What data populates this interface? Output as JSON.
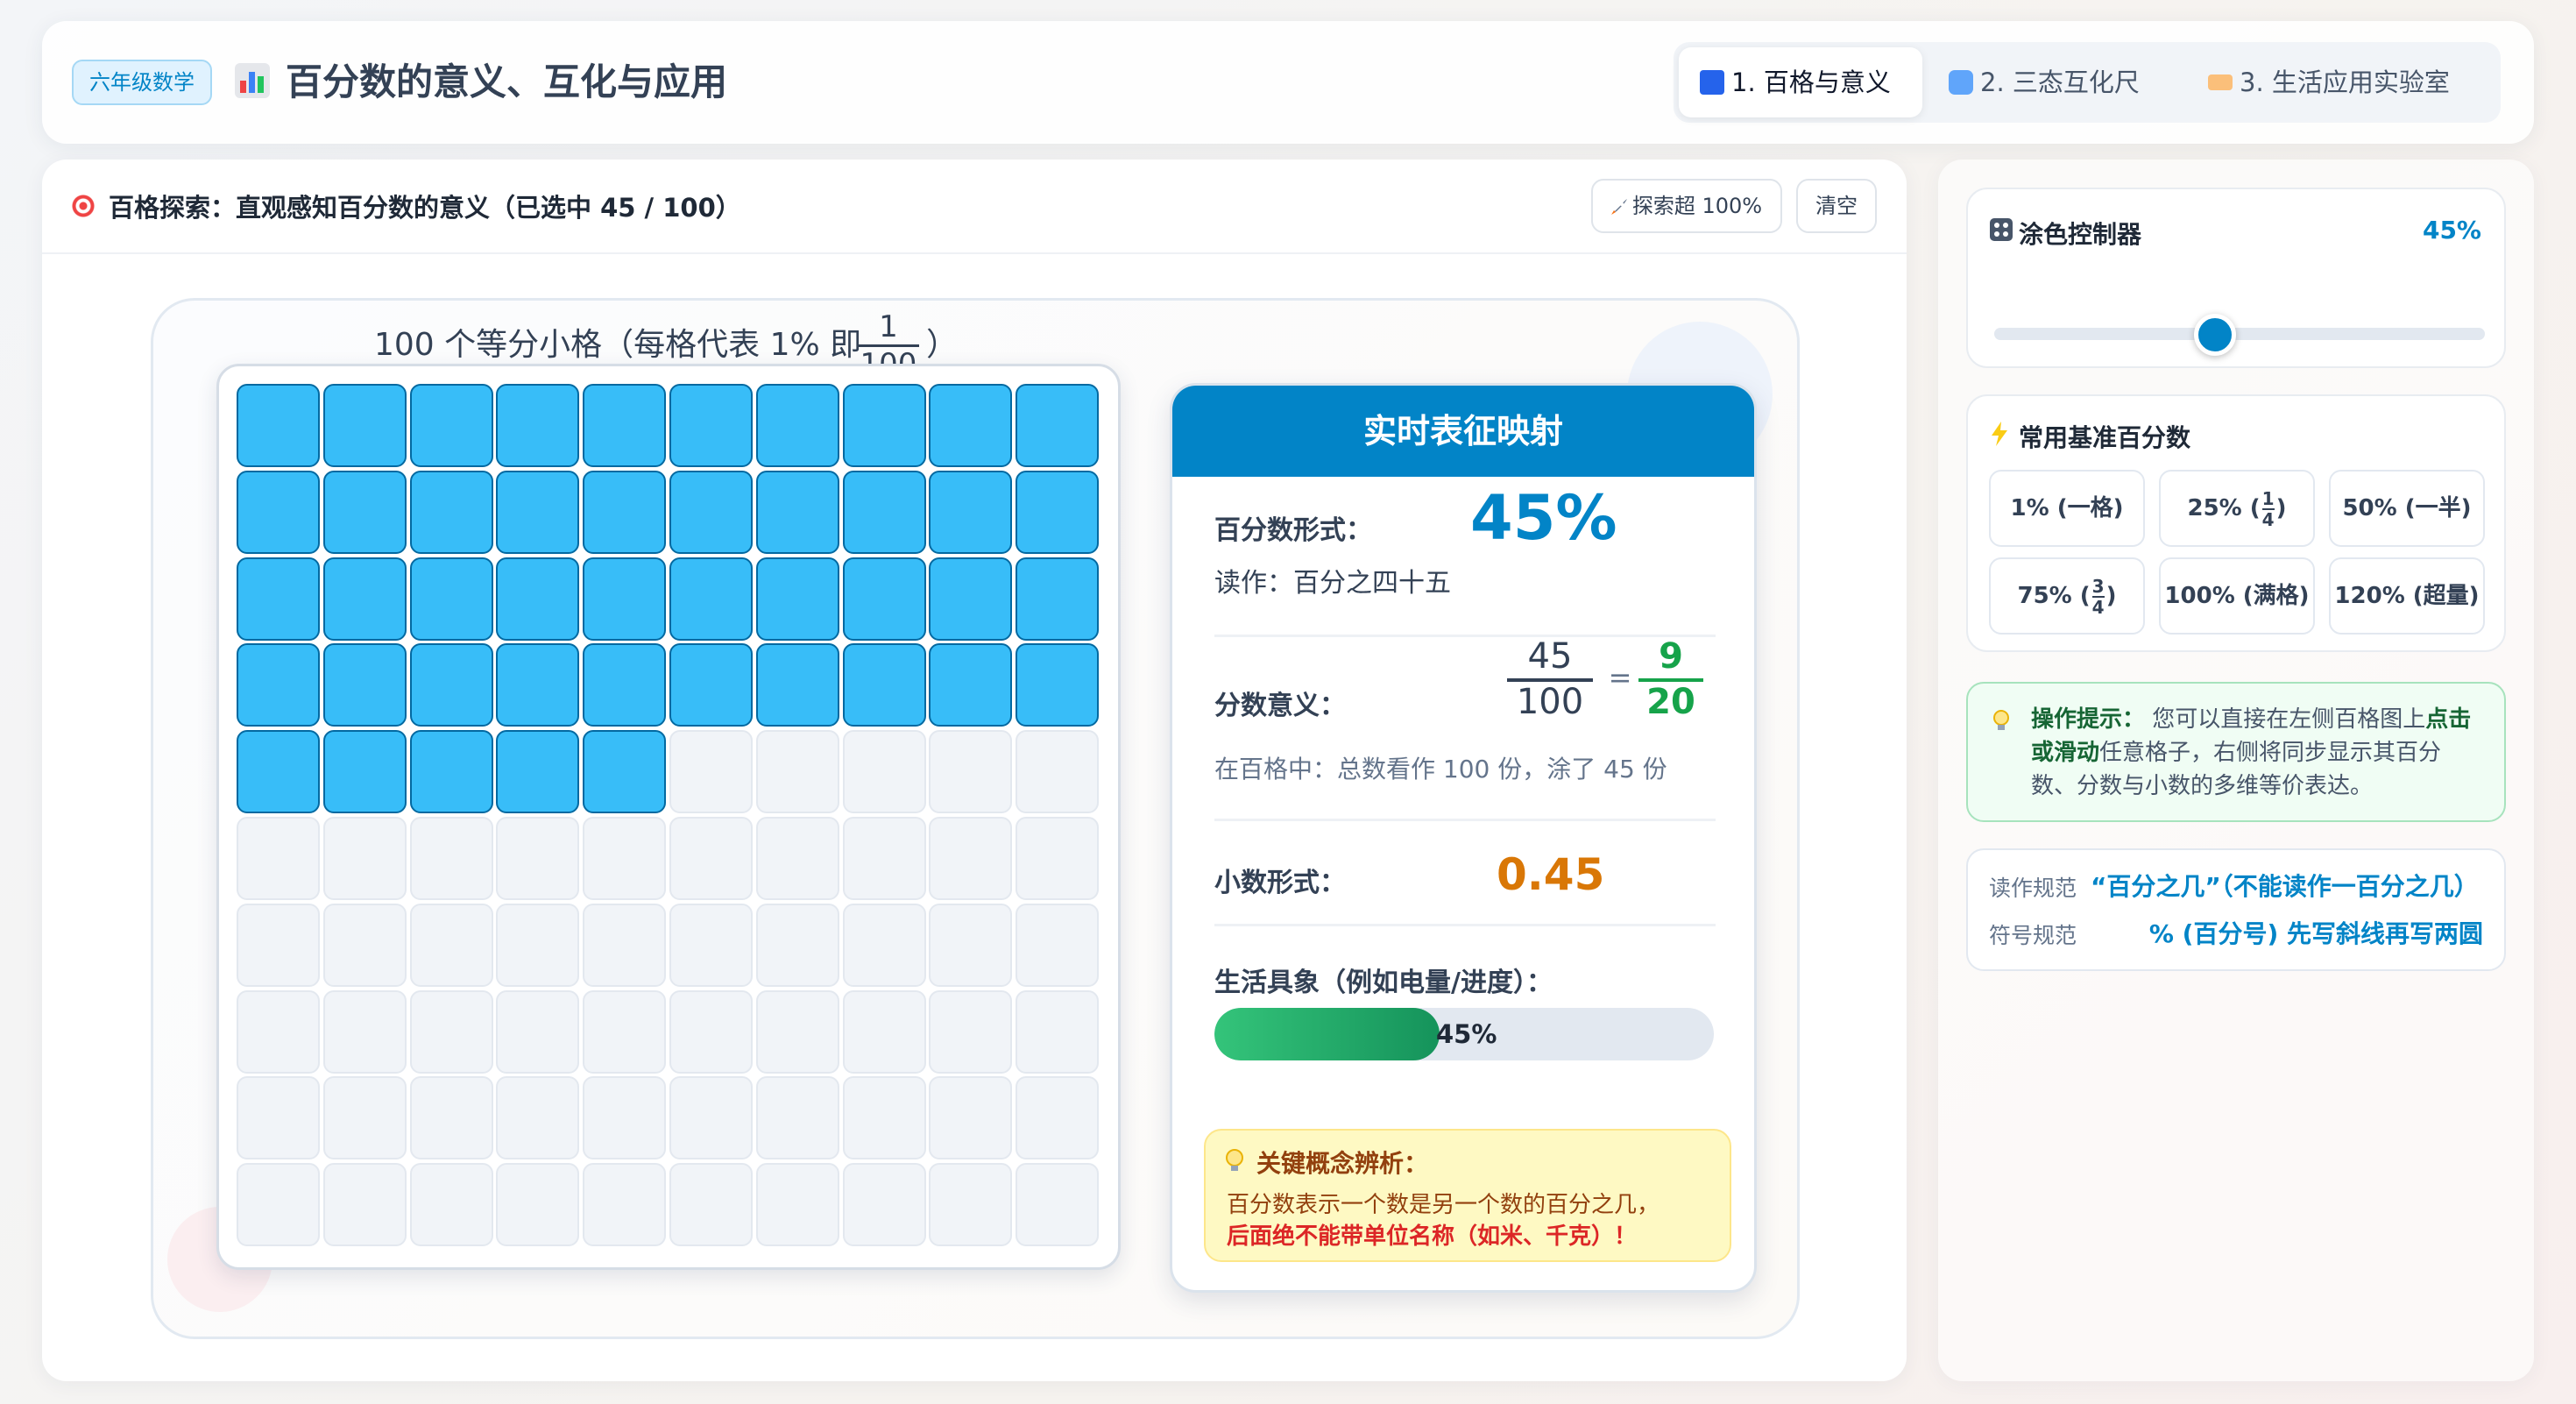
{
  "header": {
    "grade_badge": "六年级数学",
    "title": "百分数的意义、互化与应用",
    "title_icon": "bar-chart-icon",
    "tabs": [
      {
        "label": "1. 百格与意义",
        "icon": "blue-square-icon",
        "active": true
      },
      {
        "label": "2. 三态互化尺",
        "icon": "cycle-arrows-icon",
        "active": false
      },
      {
        "label": "3. 生活应用实验室",
        "icon": "ticket-icon",
        "active": false
      }
    ]
  },
  "main": {
    "title": "百格探索：直观感知百分数的意义（已选中 45 / 100）",
    "explore_button": "探索超 100%",
    "clear_button": "清空",
    "grid_caption": "100 个等分小格（每格代表 1% 即",
    "grid_caption_frac_num": "1",
    "grid_caption_frac_den": "100",
    "grid_caption_end": "）",
    "selected": 45,
    "total": 100
  },
  "card": {
    "title": "实时表征映射",
    "percent_label": "百分数形式：",
    "percent_value": "45%",
    "reading": "读作：百分之四十五",
    "fraction_label": "分数意义：",
    "frac_num": "45",
    "frac_den": "100",
    "equals": "=",
    "simp_num": "9",
    "simp_den": "20",
    "grid_meaning": "在百格中：总数看作 100 份，涂了 45 份",
    "decimal_label": "小数形式：",
    "decimal_value": "0.45",
    "life_label": "生活具象（例如电量/进度）：",
    "progress": 0.45,
    "progress_text": "45%",
    "note_title": "关键概念辨析：",
    "note_line1": "百分数表示一个数是另一个数的百分之几，",
    "note_line2": "后面绝不能带单位名称（如米、千克）！"
  },
  "side": {
    "slider_title": "涂色控制器",
    "slider_value": "45%",
    "slider_level": 0.45,
    "bench_title": "常用基准百分数",
    "bench": {
      "b1": "1% (一格)",
      "b2_pre": "25% (",
      "b2_num": "1",
      "b2_den": "4",
      "b2_post": ")",
      "b3": "50% (一半)",
      "b4_pre": "75% (",
      "b4_num": "3",
      "b4_den": "4",
      "b4_post": ")",
      "b5": "100% (满格)",
      "b6": "120% (超量)"
    },
    "tip_label": "操作提示：",
    "tip_text1": "您可以直接在左侧百格图上",
    "tip_bold": "点击或滑动",
    "tip_text2": "任意格子，右侧将同步显示其百分数、分数与小数的多维等价表达。",
    "rule1_label": "读作规范",
    "rule1_value": "“百分之几”（不能读作一百分之几）",
    "rule2_label": "符号规范",
    "rule2_value": "% (百分号) 先写斜线再写两圆"
  },
  "colors": {
    "accent": "#0284c7",
    "cell_on": "#38bdf8",
    "cell_off": "#f1f4f8",
    "green": "#16a34a",
    "orange": "#d97706",
    "note_red": "#dc2626"
  }
}
